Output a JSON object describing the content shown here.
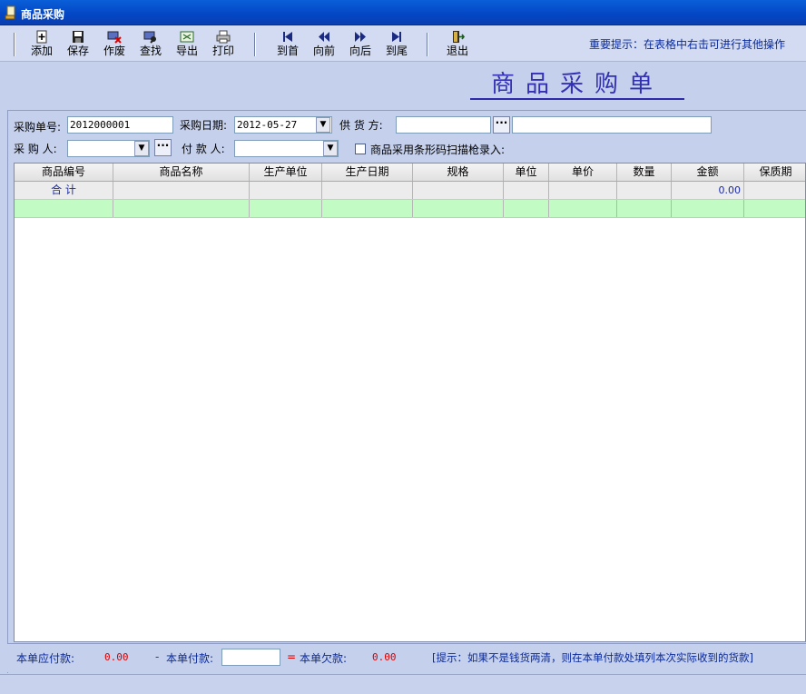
{
  "window": {
    "title": "商品采购"
  },
  "toolbar": {
    "buttons": [
      {
        "label": "添加",
        "icon": "add-icon"
      },
      {
        "label": "保存",
        "icon": "save-icon"
      },
      {
        "label": "作废",
        "icon": "void-icon"
      },
      {
        "label": "查找",
        "icon": "find-icon"
      },
      {
        "label": "导出",
        "icon": "export-icon"
      },
      {
        "label": "打印",
        "icon": "print-icon"
      },
      {
        "label": "到首",
        "icon": "first-icon"
      },
      {
        "label": "向前",
        "icon": "prev-icon"
      },
      {
        "label": "向后",
        "icon": "next-icon"
      },
      {
        "label": "到尾",
        "icon": "last-icon"
      },
      {
        "label": "退出",
        "icon": "exit-icon"
      }
    ],
    "hint": "重要提示：在表格中右击可进行其他操作"
  },
  "form": {
    "title": "商品采购单",
    "order_no_label": "采购单号:",
    "order_no": "2012000001",
    "date_label": "采购日期:",
    "date": "2012-05-27",
    "supplier_label": "供 货 方:",
    "supplier_code": "",
    "supplier_name": "",
    "buyer_label": "采 购 人:",
    "buyer": "",
    "payer_label": "付 款 人:",
    "payer": "",
    "barcode_label": "商品采用条形码扫描枪录入:",
    "barcode_checked": false
  },
  "grid": {
    "columns": [
      "商品编号",
      "商品名称",
      "生产单位",
      "生产日期",
      "规格",
      "单位",
      "单价",
      "数量",
      "金额",
      "保质期"
    ],
    "sum_label": "合  计",
    "sum_amount": "0.00"
  },
  "footer": {
    "payable_label": "本单应付款:",
    "payable": "0.00",
    "minus": "-",
    "paid_label": "本单付款:",
    "paid": "",
    "equals": "=",
    "owed_label": "本单欠款:",
    "owed": "0.00",
    "hint": "[提示：如果不是钱货两清，则在本单付款处填列本次实际收到的货款]"
  },
  "colors": {
    "title_bar": "#0346c4",
    "hint_blue": "#0a2a9c",
    "value_red": "#d40000",
    "new_row": "#c3fbc5",
    "form_title": "#3330b4"
  }
}
